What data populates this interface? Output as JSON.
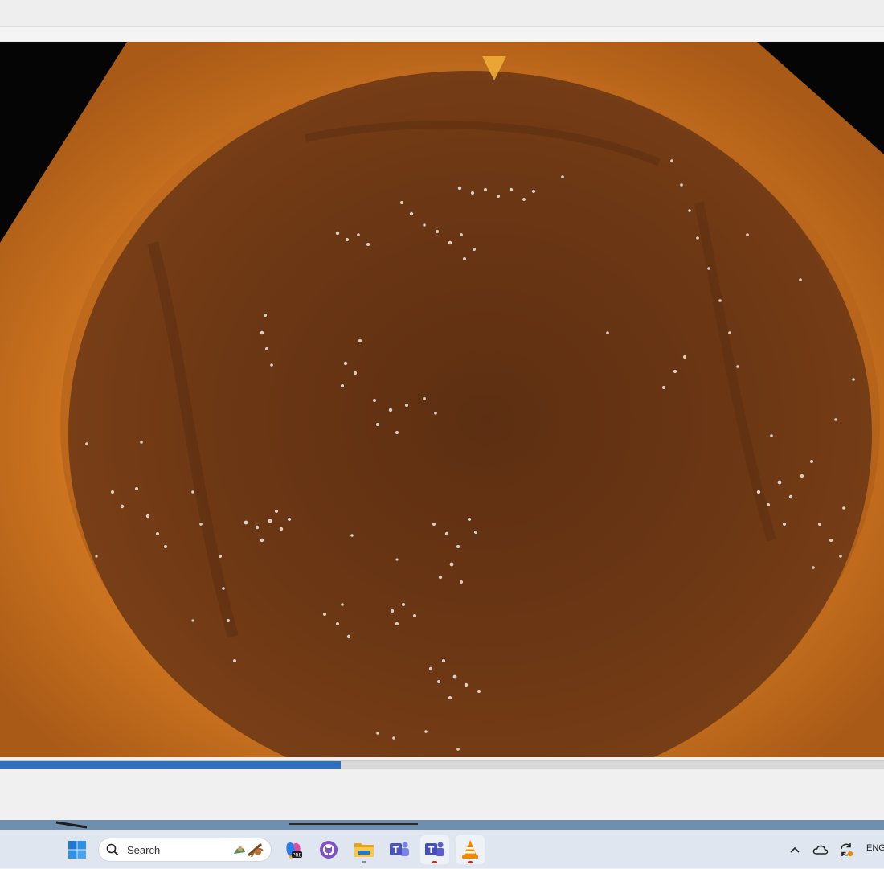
{
  "player": {
    "seek_progress": 0.385
  },
  "taskbar": {
    "search_label": "Search",
    "language": "ENG",
    "icons": [
      "windows-start-icon",
      "search-icon",
      "copilot-icon",
      "github-desktop-icon",
      "file-explorer-icon",
      "teams-classic-icon",
      "teams-icon",
      "vlc-media-player-icon",
      "show-hidden-icons-icon",
      "onedrive-icon",
      "sync-icon"
    ]
  },
  "colors": {
    "seek_fill": "#2f6fc0",
    "vlc_orange": "#f08a00",
    "teams_purple": "#5b5fc7"
  }
}
